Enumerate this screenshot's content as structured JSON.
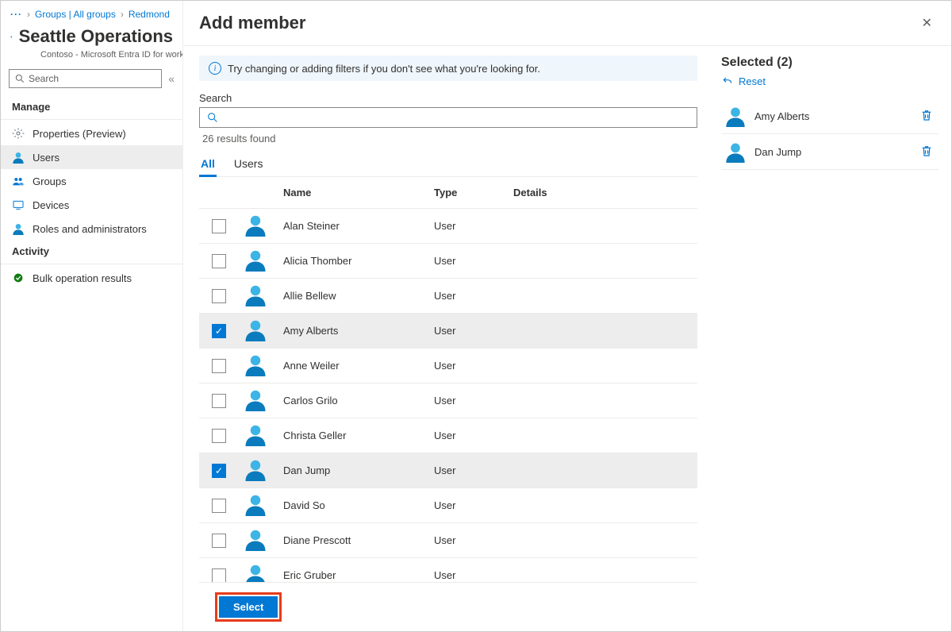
{
  "breadcrumb": {
    "dots": "···",
    "item1": "Groups | All groups",
    "item2": "Redmond"
  },
  "header": {
    "title": "Seattle Operations",
    "subtitle": "Contoso - Microsoft Entra ID for workfo"
  },
  "side_search": {
    "placeholder": "Search"
  },
  "sidebar": {
    "manage_label": "Manage",
    "items": [
      {
        "label": "Properties (Preview)",
        "icon": "gear"
      },
      {
        "label": "Users",
        "icon": "user",
        "active": true
      },
      {
        "label": "Groups",
        "icon": "group"
      },
      {
        "label": "Devices",
        "icon": "device"
      },
      {
        "label": "Roles and administrators",
        "icon": "role"
      }
    ],
    "activity_label": "Activity",
    "activity_items": [
      {
        "label": "Bulk operation results",
        "icon": "bulk"
      }
    ]
  },
  "modal": {
    "title": "Add member",
    "info_text": "Try changing or adding filters if you don't see what you're looking for.",
    "search_label": "Search",
    "results_text": "26 results found",
    "tabs": {
      "all": "All",
      "users": "Users"
    },
    "columns": {
      "name": "Name",
      "type": "Type",
      "details": "Details"
    },
    "rows": [
      {
        "name": "Alan Steiner",
        "type": "User",
        "checked": false
      },
      {
        "name": "Alicia Thomber",
        "type": "User",
        "checked": false
      },
      {
        "name": "Allie Bellew",
        "type": "User",
        "checked": false
      },
      {
        "name": "Amy Alberts",
        "type": "User",
        "checked": true
      },
      {
        "name": "Anne Weiler",
        "type": "User",
        "checked": false
      },
      {
        "name": "Carlos Grilo",
        "type": "User",
        "checked": false
      },
      {
        "name": "Christa Geller",
        "type": "User",
        "checked": false
      },
      {
        "name": "Dan Jump",
        "type": "User",
        "checked": true
      },
      {
        "name": "David So",
        "type": "User",
        "checked": false
      },
      {
        "name": "Diane Prescott",
        "type": "User",
        "checked": false
      },
      {
        "name": "Eric Gruber",
        "type": "User",
        "checked": false
      }
    ],
    "select_button": "Select"
  },
  "selected": {
    "header": "Selected (2)",
    "reset": "Reset",
    "items": [
      {
        "name": "Amy Alberts"
      },
      {
        "name": "Dan Jump"
      }
    ]
  }
}
